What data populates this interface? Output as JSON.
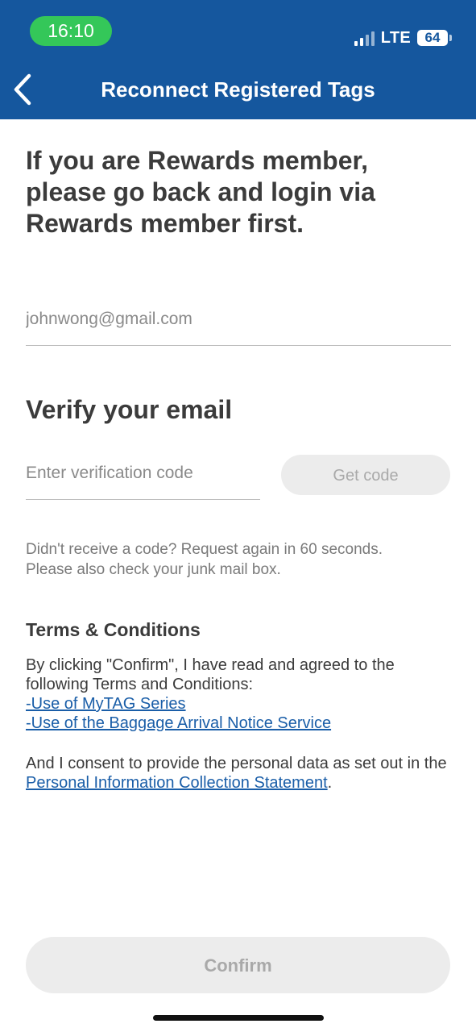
{
  "status_bar": {
    "time": "16:10",
    "network": "LTE",
    "battery": "64"
  },
  "nav": {
    "back_icon": "chevron-left-icon",
    "title": "Reconnect Registered Tags"
  },
  "heading": "If you are Rewards member, please go back and login via Rewards member first.",
  "email_field": {
    "placeholder": "johnwong@gmail.com",
    "value": ""
  },
  "verify": {
    "title": "Verify your email",
    "code_placeholder": "Enter verification code",
    "get_code_label": "Get code",
    "hint_line1": "Didn't receive a code? Request again in 60 seconds.",
    "hint_line2": "Please also check your junk mail box."
  },
  "terms": {
    "title": "Terms & Conditions",
    "intro": "By clicking \"Confirm\", I have read and agreed to the following Terms and Conditions:",
    "link1": "-Use of MyTAG Series",
    "link2": "-Use of the Baggage Arrival Notice Service",
    "consent_prefix": "And I consent to provide the personal data as set out in the ",
    "consent_link": "Personal Information Collection Statement",
    "consent_suffix": "."
  },
  "confirm_label": "Confirm",
  "colors": {
    "header": "#15579e",
    "time_pill": "#34c759",
    "link": "#1a5ea8",
    "disabled_button": "#ececec"
  }
}
